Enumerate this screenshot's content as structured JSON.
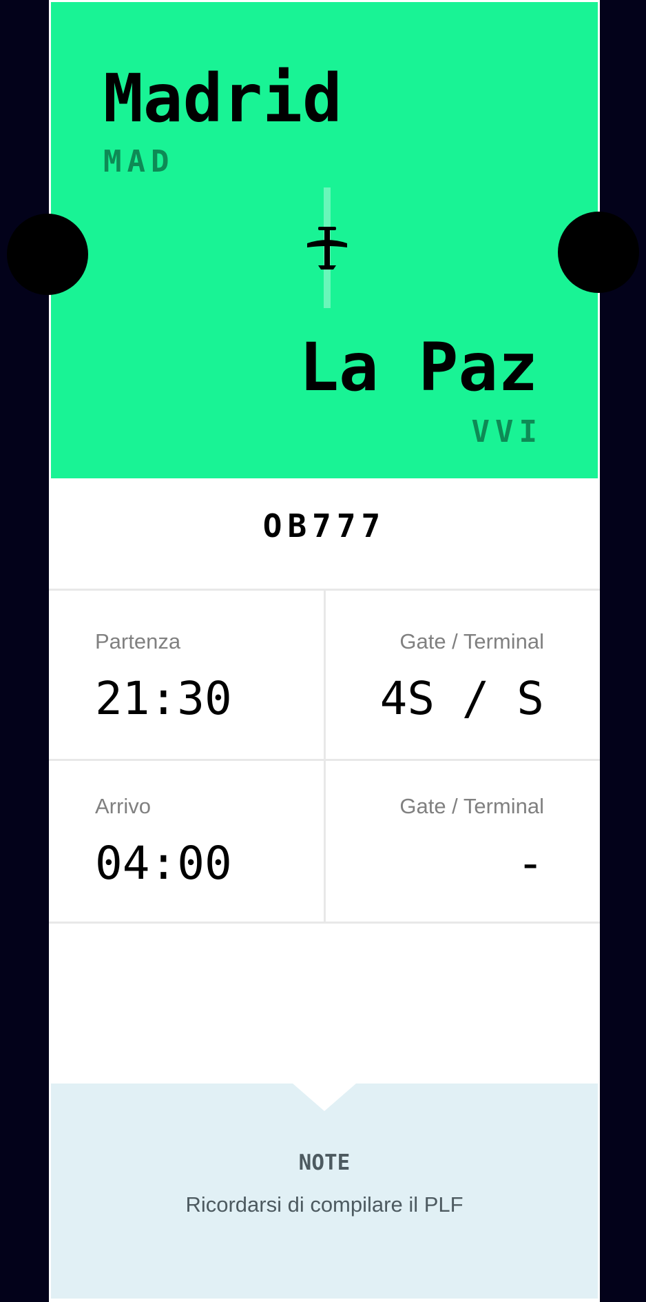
{
  "route": {
    "origin": {
      "city": "Madrid",
      "code": "MAD"
    },
    "destination": {
      "city": "La Paz",
      "code": "VVI"
    },
    "icon": "airplane-icon"
  },
  "flight": {
    "number": "OB777"
  },
  "departure": {
    "label": "Partenza",
    "time": "21:30",
    "gate_label": "Gate / Terminal",
    "gate_value": "4S / S"
  },
  "arrival": {
    "label": "Arrivo",
    "time": "04:00",
    "gate_label": "Gate / Terminal",
    "gate_value": "-"
  },
  "note": {
    "title": "NOTE",
    "text": "Ricordarsi di compilare il PLF"
  },
  "colors": {
    "background": "#03021a",
    "accent": "#19f395",
    "code_text": "#0e8a55",
    "note_bg": "#e1f0f5"
  }
}
